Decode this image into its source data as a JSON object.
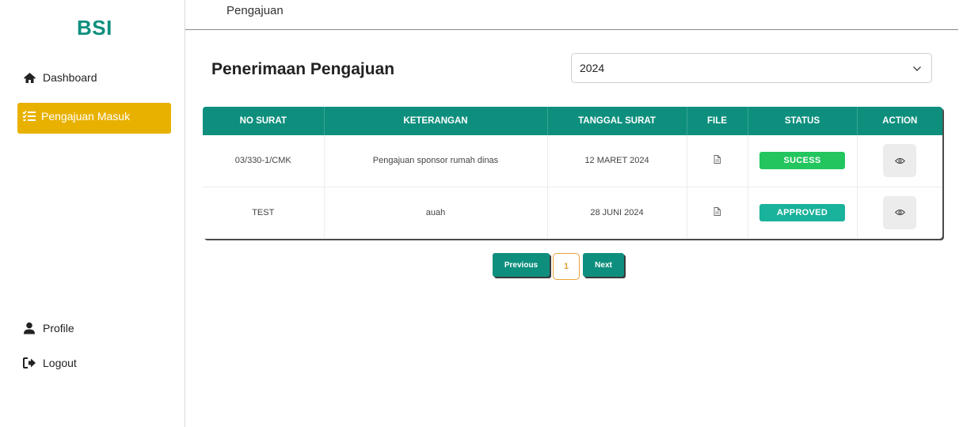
{
  "brand": "BSI",
  "topbar": {
    "title": "Pengajuan"
  },
  "sidebar": {
    "items": [
      {
        "label": "Dashboard",
        "icon": "home-icon"
      },
      {
        "label": "Pengajuan Masuk",
        "icon": "list-check-icon",
        "active": true
      },
      {
        "label": "Profile",
        "icon": "user-icon"
      },
      {
        "label": "Logout",
        "icon": "logout-icon"
      }
    ]
  },
  "main": {
    "title": "Penerimaan Pengajuan",
    "year_select": {
      "value": "2024"
    }
  },
  "table": {
    "headers": [
      "NO SURAT",
      "KETERANGAN",
      "TANGGAL SURAT",
      "FILE",
      "STATUS",
      "ACTION"
    ],
    "rows": [
      {
        "no_surat": "03/330-1/CMK",
        "keterangan": "Pengajuan sponsor rumah dinas",
        "tanggal": "12 MARET 2024",
        "status": "SUCESS",
        "status_color": "#22c55e"
      },
      {
        "no_surat": "TEST",
        "keterangan": "auah",
        "tanggal": "28 JUNI 2024",
        "status": "APPROVED",
        "status_color": "#19b29b"
      }
    ]
  },
  "pagination": {
    "previous": "Previous",
    "current": "1",
    "next": "Next"
  },
  "colors": {
    "primary": "#0e8f7e",
    "active_nav": "#e8b100",
    "page_accent": "#e8a13a"
  }
}
